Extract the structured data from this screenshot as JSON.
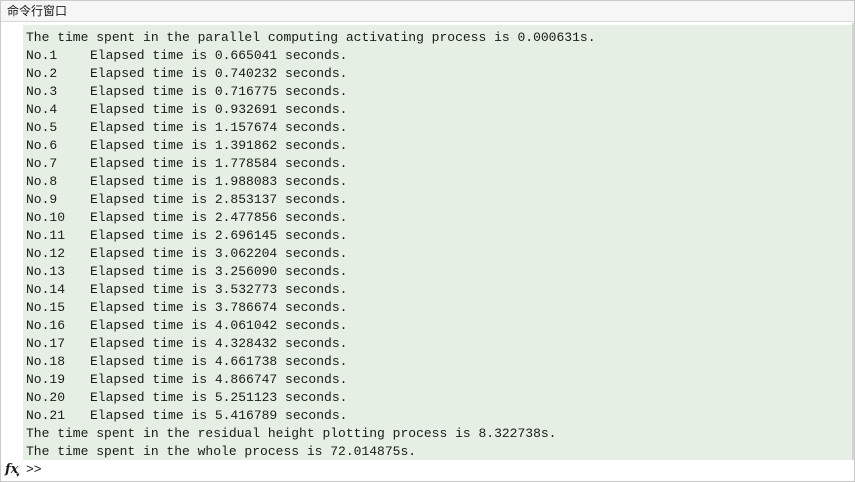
{
  "window": {
    "title": "命令行窗口"
  },
  "console": {
    "header_line": "The time spent in the parallel computing activating process is 0.000631s.",
    "runs": [
      {
        "no": "No.1",
        "text": "Elapsed time is 0.665041 seconds."
      },
      {
        "no": "No.2",
        "text": "Elapsed time is 0.740232 seconds."
      },
      {
        "no": "No.3",
        "text": "Elapsed time is 0.716775 seconds."
      },
      {
        "no": "No.4",
        "text": "Elapsed time is 0.932691 seconds."
      },
      {
        "no": "No.5",
        "text": "Elapsed time is 1.157674 seconds."
      },
      {
        "no": "No.6",
        "text": "Elapsed time is 1.391862 seconds."
      },
      {
        "no": "No.7",
        "text": "Elapsed time is 1.778584 seconds."
      },
      {
        "no": "No.8",
        "text": "Elapsed time is 1.988083 seconds."
      },
      {
        "no": "No.9",
        "text": "Elapsed time is 2.853137 seconds."
      },
      {
        "no": "No.10",
        "text": "Elapsed time is 2.477856 seconds."
      },
      {
        "no": "No.11",
        "text": "Elapsed time is 2.696145 seconds."
      },
      {
        "no": "No.12",
        "text": "Elapsed time is 3.062204 seconds."
      },
      {
        "no": "No.13",
        "text": "Elapsed time is 3.256090 seconds."
      },
      {
        "no": "No.14",
        "text": "Elapsed time is 3.532773 seconds."
      },
      {
        "no": "No.15",
        "text": "Elapsed time is 3.786674 seconds."
      },
      {
        "no": "No.16",
        "text": "Elapsed time is 4.061042 seconds."
      },
      {
        "no": "No.17",
        "text": "Elapsed time is 4.328432 seconds."
      },
      {
        "no": "No.18",
        "text": "Elapsed time is 4.661738 seconds."
      },
      {
        "no": "No.19",
        "text": "Elapsed time is 4.866747 seconds."
      },
      {
        "no": "No.20",
        "text": "Elapsed time is 5.251123 seconds."
      },
      {
        "no": "No.21",
        "text": "Elapsed time is 5.416789 seconds."
      }
    ],
    "residual_line": "The time spent in the residual height plotting process is 8.322738s.",
    "total_line": "The time spent in the whole process is 72.014875s."
  },
  "prompt": {
    "fx_icon": "function-browser-icon",
    "fx_label": "fx",
    "symbol": ">>",
    "value": ""
  },
  "colors": {
    "console_background": "#e6efe3",
    "text": "#1a1a1a"
  }
}
